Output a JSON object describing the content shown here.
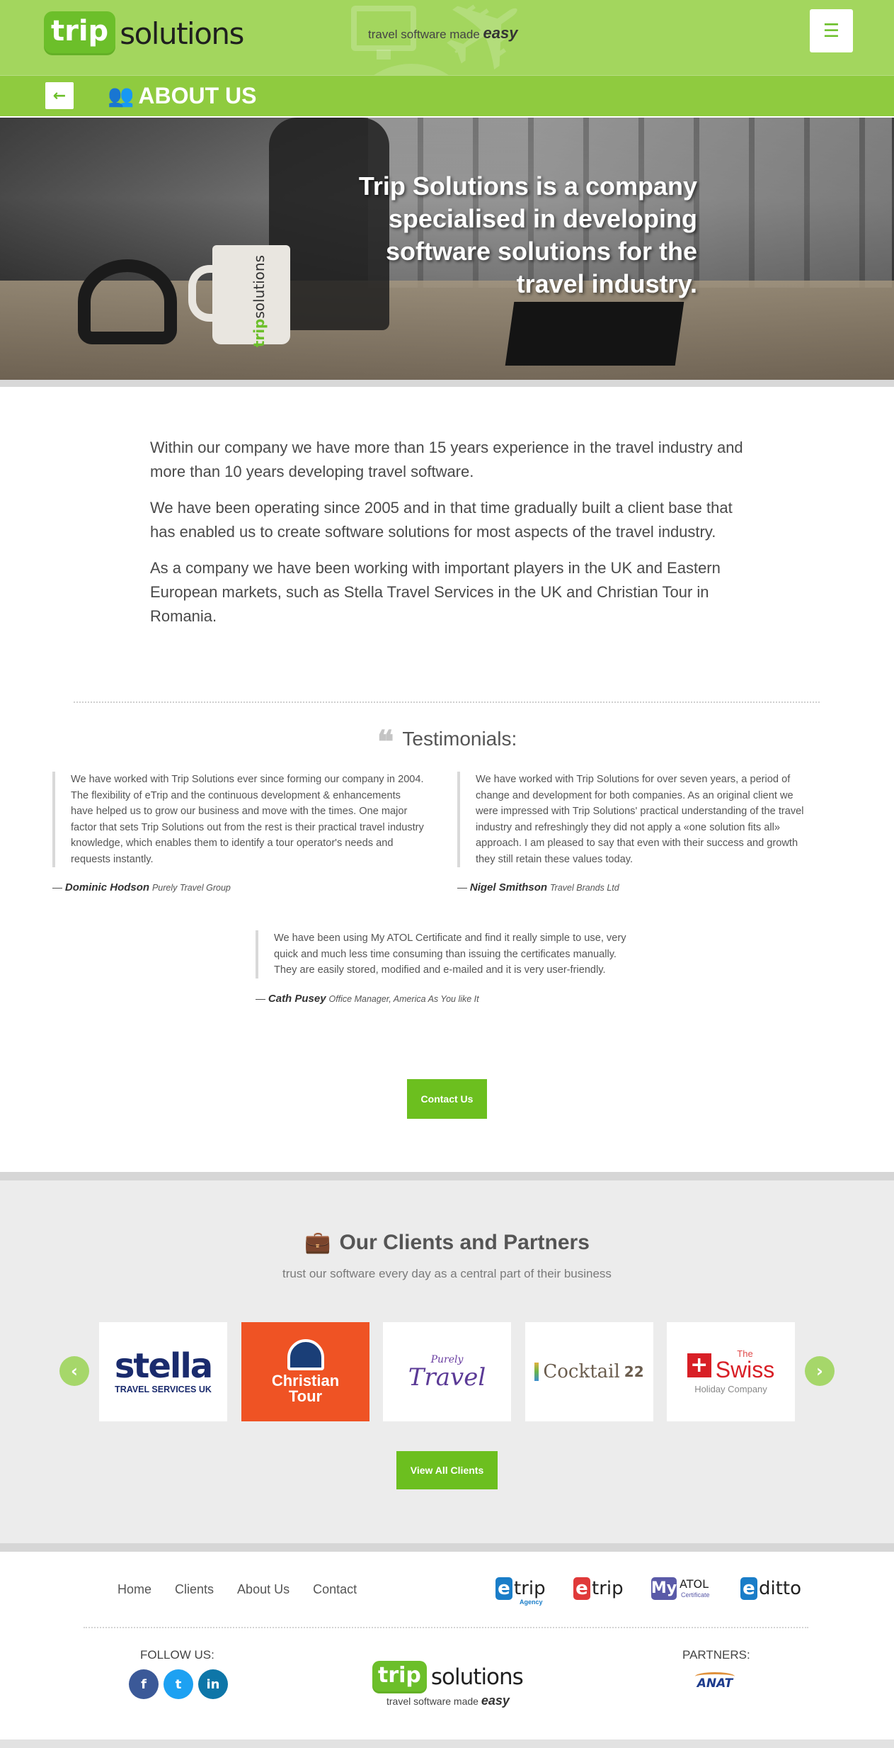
{
  "header": {
    "logo_trip": "trip",
    "logo_solutions": "solutions",
    "tagline": "travel software made",
    "tagline_em": "easy",
    "menu_icon": "hamburger-icon",
    "back_icon": "arrow-left-icon",
    "page_title": "ABOUT US",
    "users_icon": "users-icon"
  },
  "hero": {
    "headline": "Trip Solutions is a company specialised in developing software solutions for the travel industry.",
    "mug_trip": "trip",
    "mug_solutions": "solutions"
  },
  "intro": {
    "p1": "Within our company we have more than 15 years experience in the travel industry and more than 10 years developing travel software.",
    "p2": "We have been operating since 2005 and in that time gradually built a client base that has enabled us to create software solutions for most aspects of the travel industry.",
    "p3": "As a company we have been working with important players in the UK and Eastern European markets, such as Stella Travel Services in the UK and Christian Tour in Romania."
  },
  "testimonials": {
    "title": "Testimonials:",
    "quote_icon": "quote-icon",
    "items": [
      {
        "text": "We have worked with Trip Solutions ever since forming our company in 2004. The flexibility of eTrip and the continuous development & enhancements have helped us to grow our business and move with the times. One major factor that sets Trip Solutions out from the rest is their practical travel industry knowledge, which enables them to identify a tour operator's needs and requests instantly.",
        "dash": "—",
        "name": "Dominic Hodson",
        "org": "Purely Travel Group"
      },
      {
        "text": "We have worked with Trip Solutions for over seven years, a period of change and development for both companies. As an original client we were impressed with Trip Solutions' practical understanding of the travel industry and refreshingly they did not apply a «one solution fits all» approach. I am pleased to say that even with their success and growth they still retain these values today.",
        "dash": "—",
        "name": "Nigel Smithson",
        "org": "Travel Brands Ltd"
      },
      {
        "text": "We have been using My ATOL Certificate and find it really simple to use, very quick and much less time consuming than issuing the certificates manually. They are easily stored, modified and e-mailed and it is very user-friendly.",
        "dash": "—",
        "name": "Cath Pusey",
        "org": "Office Manager, America As You like It"
      }
    ],
    "contact_label": "Contact Us"
  },
  "clients": {
    "title": "Our Clients and Partners",
    "briefcase_icon": "briefcase-icon",
    "subtitle": "trust our software every day as a central part of their business",
    "prev_icon": "chevron-left-icon",
    "next_icon": "chevron-right-icon",
    "logos": {
      "stella_name": "stella",
      "stella_sub": "TRAVEL SERVICES UK",
      "christian_line1": "Christian",
      "christian_line2": "Tour",
      "purely_small": "Purely",
      "purely_big": "Travel",
      "cocktail_name": "Cocktail",
      "cocktail_num": "22",
      "swiss_the": "The",
      "swiss_name": "Swiss",
      "swiss_sub": "Holiday Company"
    },
    "view_all_label": "View All Clients"
  },
  "footer": {
    "nav": [
      "Home",
      "Clients",
      "About Us",
      "Contact"
    ],
    "products": {
      "etrip_agency_badge": "e",
      "etrip_agency_name": "trip",
      "etrip_agency_sub": "Agency",
      "etrip_badge": "e",
      "etrip_name": "trip",
      "myatol_badge": "My",
      "myatol_name": "ATOL",
      "myatol_sub": "Certificate",
      "editto_badge": "e",
      "editto_name": "ditto"
    },
    "follow_label": "FOLLOW US:",
    "social": {
      "facebook": "f",
      "twitter": "t",
      "linkedin": "in"
    },
    "logo_trip": "trip",
    "logo_solutions": "solutions",
    "tagline": "travel software made",
    "tagline_em": "easy",
    "partners_label": "PARTNERS:",
    "anat_name": "ANAT"
  },
  "colors": {
    "header_green": "#a3d65e",
    "subbar_green": "#8fcb3f",
    "button_green": "#6cbf1f",
    "christian_tour_orange": "#ef5324"
  }
}
